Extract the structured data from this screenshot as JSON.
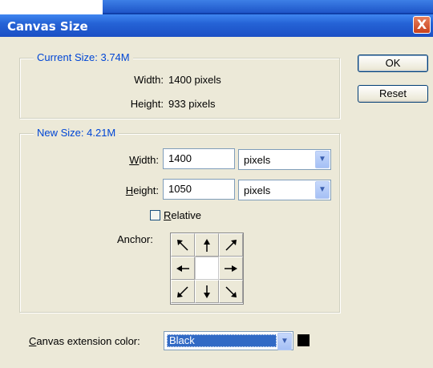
{
  "dialog": {
    "title": "Canvas Size",
    "close_glyph": "X"
  },
  "current_size": {
    "legend": "Current Size: 3.74M",
    "width_label": "Width:",
    "width_value": "1400 pixels",
    "height_label": "Height:",
    "height_value": "933 pixels"
  },
  "new_size": {
    "legend": "New Size: 4.21M",
    "width_label_ul": "W",
    "width_label_rest": "idth:",
    "width_value": "1400",
    "width_unit": "pixels",
    "height_label_ul": "H",
    "height_label_rest": "eight:",
    "height_value": "1050",
    "height_unit": "pixels",
    "relative_ul": "R",
    "relative_rest": "elative",
    "relative_checked": false,
    "anchor_label": "Anchor:"
  },
  "buttons": {
    "ok": "OK",
    "reset": "Reset"
  },
  "extension": {
    "label_ul": "C",
    "label_rest": "anvas extension color:",
    "value": "Black",
    "swatch_color": "#000000"
  },
  "icons": {
    "dropdown": "chevron-down-icon",
    "arrows": [
      "arrow-up-left-icon",
      "arrow-up-icon",
      "arrow-up-right-icon",
      "arrow-left-icon",
      "anchor-center",
      "arrow-right-icon",
      "arrow-down-left-icon",
      "arrow-down-icon",
      "arrow-down-right-icon"
    ]
  }
}
